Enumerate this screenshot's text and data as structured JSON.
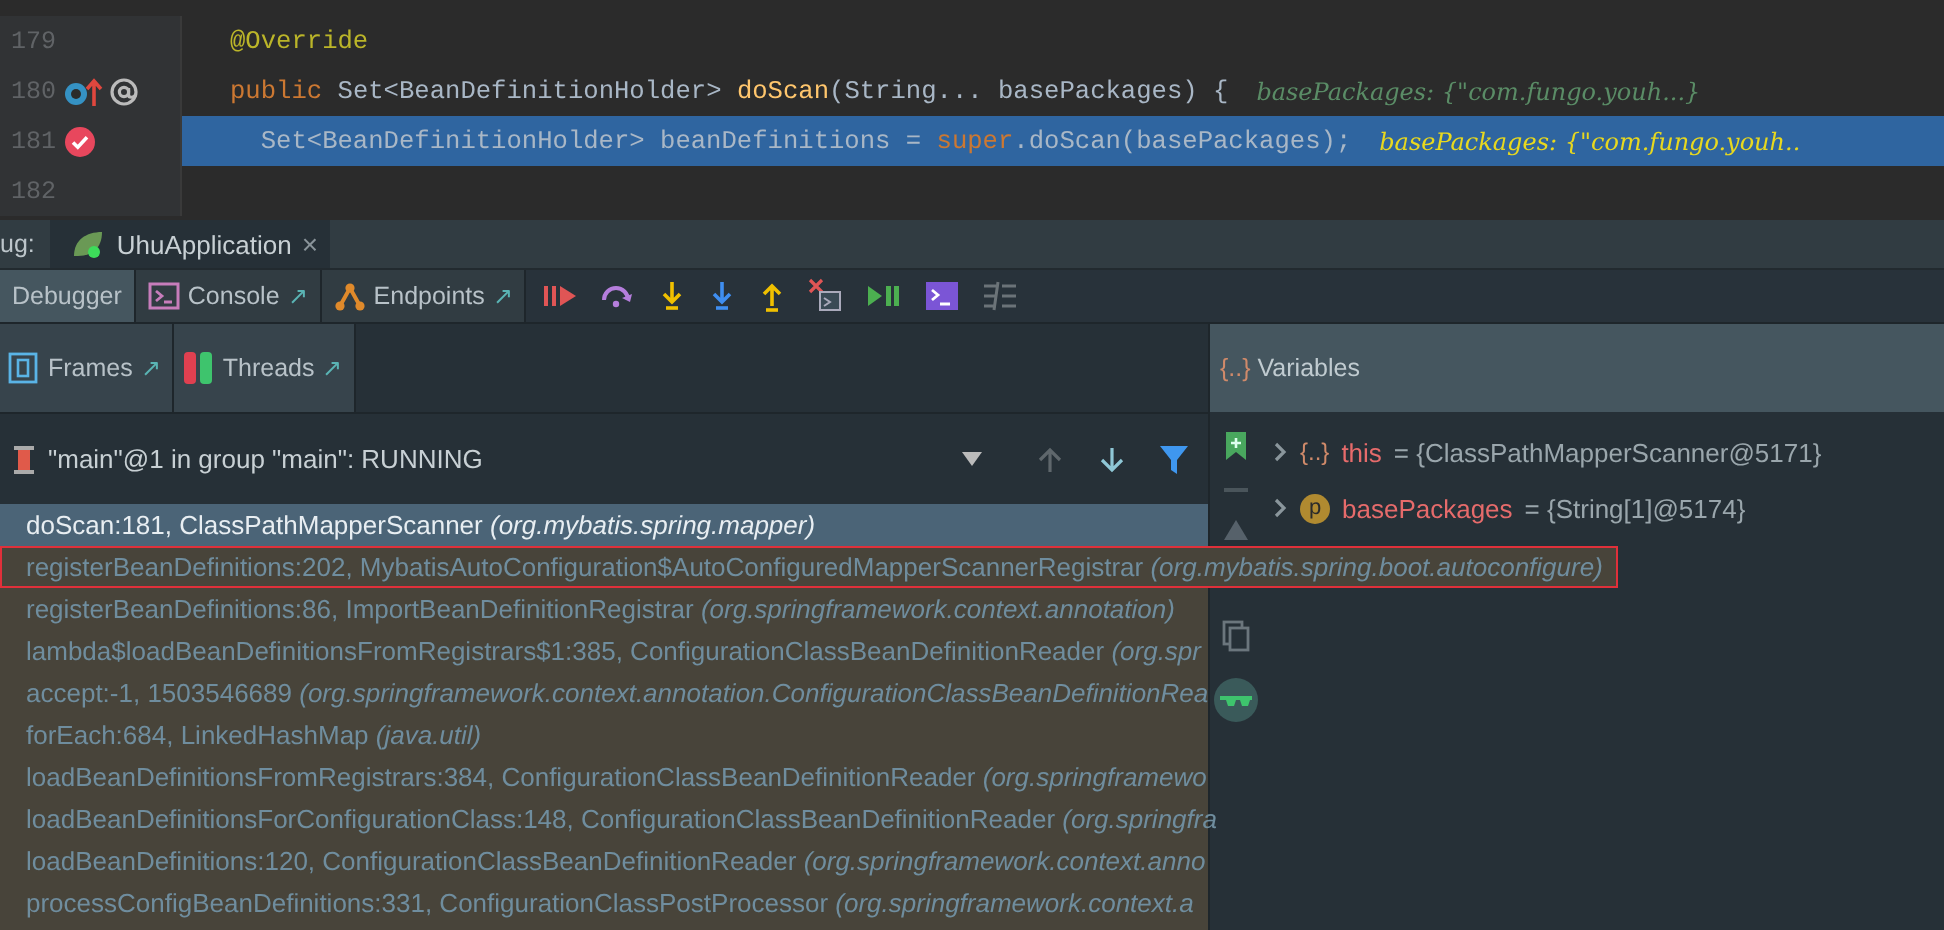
{
  "editor": {
    "lines": [
      {
        "number": "179",
        "selected": false,
        "kind": "plain",
        "tokens": [
          {
            "text": "@Override",
            "kind": "annotation"
          }
        ]
      },
      {
        "number": "180",
        "selected": false,
        "kind": "override",
        "tokens": [
          {
            "text": "public ",
            "kind": "keyword"
          },
          {
            "text": "Set<BeanDefinitionHolder> ",
            "kind": "plain"
          },
          {
            "text": "doScan",
            "kind": "method"
          },
          {
            "text": "(String... basePackages) {",
            "kind": "plain"
          }
        ],
        "hint": "basePackages: {\"com.fungo.youh...}"
      },
      {
        "number": "181",
        "selected": true,
        "kind": "breakpoint",
        "tokens": [
          {
            "text": "  Set<BeanDefinitionHolder> beanDefinitions = ",
            "kind": "plain"
          },
          {
            "text": "super",
            "kind": "keyword"
          },
          {
            "text": ".doScan(basePackages);",
            "kind": "plain"
          }
        ],
        "hint": "basePackages: {\"com.fungo.youh.."
      },
      {
        "number": "182",
        "selected": false,
        "kind": "plain"
      }
    ]
  },
  "debug": {
    "label": "ug:",
    "session_tab": {
      "title": "UhuApplication",
      "close": "×"
    }
  },
  "tabs": [
    {
      "label": "Debugger",
      "selected": true
    },
    {
      "label": "Console",
      "selected": false,
      "pin": "↗"
    },
    {
      "label": "Endpoints",
      "selected": false,
      "pin": "↗"
    }
  ],
  "frames_tabs": [
    {
      "label": "Frames",
      "pin": "↗"
    },
    {
      "label": "Threads",
      "pin": "↗"
    }
  ],
  "thread": {
    "value": "\"main\"@1 in group \"main\": RUNNING"
  },
  "frames": [
    {
      "text": "doScan:181, ClassPathMapperScanner *(org.mybatis.spring.mapper)*",
      "selected": true,
      "outlined": false
    },
    {
      "text": "registerBeanDefinitions:202, MybatisAutoConfiguration$AutoConfiguredMapperScannerRegistrar *(org.mybatis.spring.boot.autoconfigure)*",
      "selected": false,
      "outlined": true
    },
    {
      "text": "registerBeanDefinitions:86, ImportBeanDefinitionRegistrar *(org.springframework.context.annotation)*",
      "selected": false,
      "outlined": false
    },
    {
      "text": "lambda$loadBeanDefinitionsFromRegistrars$1:385, ConfigurationClassBeanDefinitionReader *(org.spr*",
      "selected": false,
      "outlined": false
    },
    {
      "text": "accept:-1, 1503546689 *(org.springframework.context.annotation.ConfigurationClassBeanDefinitionRea*",
      "selected": false,
      "outlined": false
    },
    {
      "text": "forEach:684, LinkedHashMap *(java.util)*",
      "selected": false,
      "outlined": false
    },
    {
      "text": "loadBeanDefinitionsFromRegistrars:384, ConfigurationClassBeanDefinitionReader *(org.springframewo*",
      "selected": false,
      "outlined": false
    },
    {
      "text": "loadBeanDefinitionsForConfigurationClass:148, ConfigurationClassBeanDefinitionReader *(org.springfra*",
      "selected": false,
      "outlined": false
    },
    {
      "text": "loadBeanDefinitions:120, ConfigurationClassBeanDefinitionReader *(org.springframework.context.anno*",
      "selected": false,
      "outlined": false
    },
    {
      "text": "processConfigBeanDefinitions:331, ConfigurationClassPostProcessor *(org.springframework.context.a*",
      "selected": false,
      "outlined": false
    }
  ],
  "variables": {
    "title": "Variables",
    "title_icon": "{..}",
    "items": [
      {
        "kind": "object",
        "icon_text": "{..}",
        "name": "this",
        "value": "= {ClassPathMapperScanner@5171}"
      },
      {
        "kind": "parameter",
        "icon_text": "p",
        "name": "basePackages",
        "value": "= {String[1]@5174}"
      }
    ]
  }
}
